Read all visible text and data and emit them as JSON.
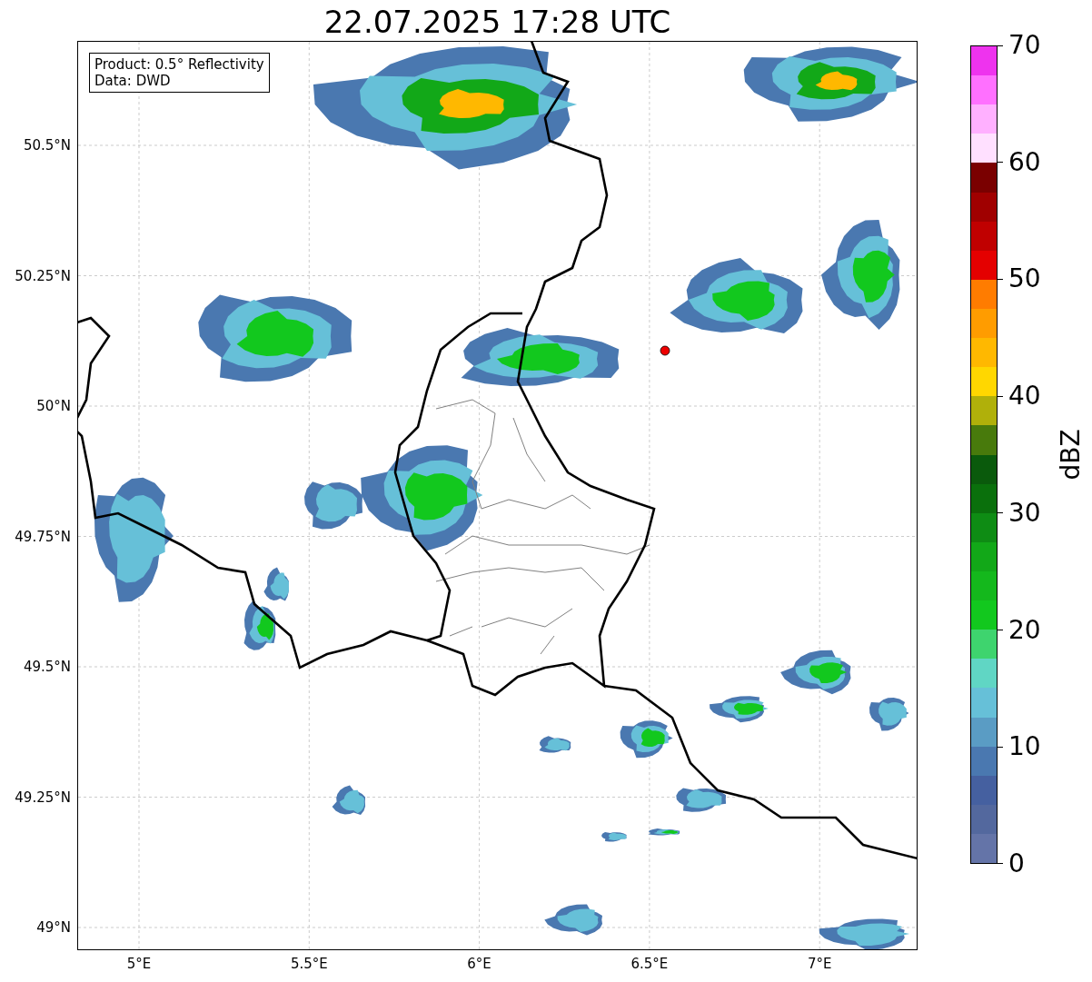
{
  "title": "22.07.2025 17:28 UTC",
  "legend": {
    "lines": [
      "Product: 0.5° Reflectivity",
      "Data: DWD"
    ]
  },
  "map": {
    "y_ticks": [
      "50.5°N",
      "50.25°N",
      "50°N",
      "49.75°N",
      "49.5°N",
      "49.25°N",
      "49°N"
    ],
    "x_ticks": [
      "5°E",
      "5.5°E",
      "6°E",
      "6.5°E",
      "7°E"
    ]
  },
  "colorbar": {
    "label": "dBZ",
    "ticks": [
      "70",
      "60",
      "50",
      "40",
      "30",
      "20",
      "10",
      "0"
    ],
    "bands": [
      {
        "color": "#ee33ee"
      },
      {
        "color": "#ff70ff"
      },
      {
        "color": "#ffb0ff"
      },
      {
        "color": "#ffe0ff"
      },
      {
        "color": "#7a0000"
      },
      {
        "color": "#a00000"
      },
      {
        "color": "#c00000"
      },
      {
        "color": "#e40000"
      },
      {
        "color": "#ff7c00"
      },
      {
        "color": "#ff9c00"
      },
      {
        "color": "#ffb800"
      },
      {
        "color": "#ffd700"
      },
      {
        "color": "#b0b00a"
      },
      {
        "color": "#487a0c"
      },
      {
        "color": "#0a5a0c"
      },
      {
        "color": "#0a700c"
      },
      {
        "color": "#0e8c14"
      },
      {
        "color": "#12a818"
      },
      {
        "color": "#14b81c"
      },
      {
        "color": "#12c81e"
      },
      {
        "color": "#3ed46e"
      },
      {
        "color": "#60d6c4"
      },
      {
        "color": "#66c0d8"
      },
      {
        "color": "#5a9cc4"
      },
      {
        "color": "#4a78b0"
      },
      {
        "color": "#4560a0"
      },
      {
        "color": "#53689e"
      },
      {
        "color": "#6474a8"
      }
    ]
  }
}
